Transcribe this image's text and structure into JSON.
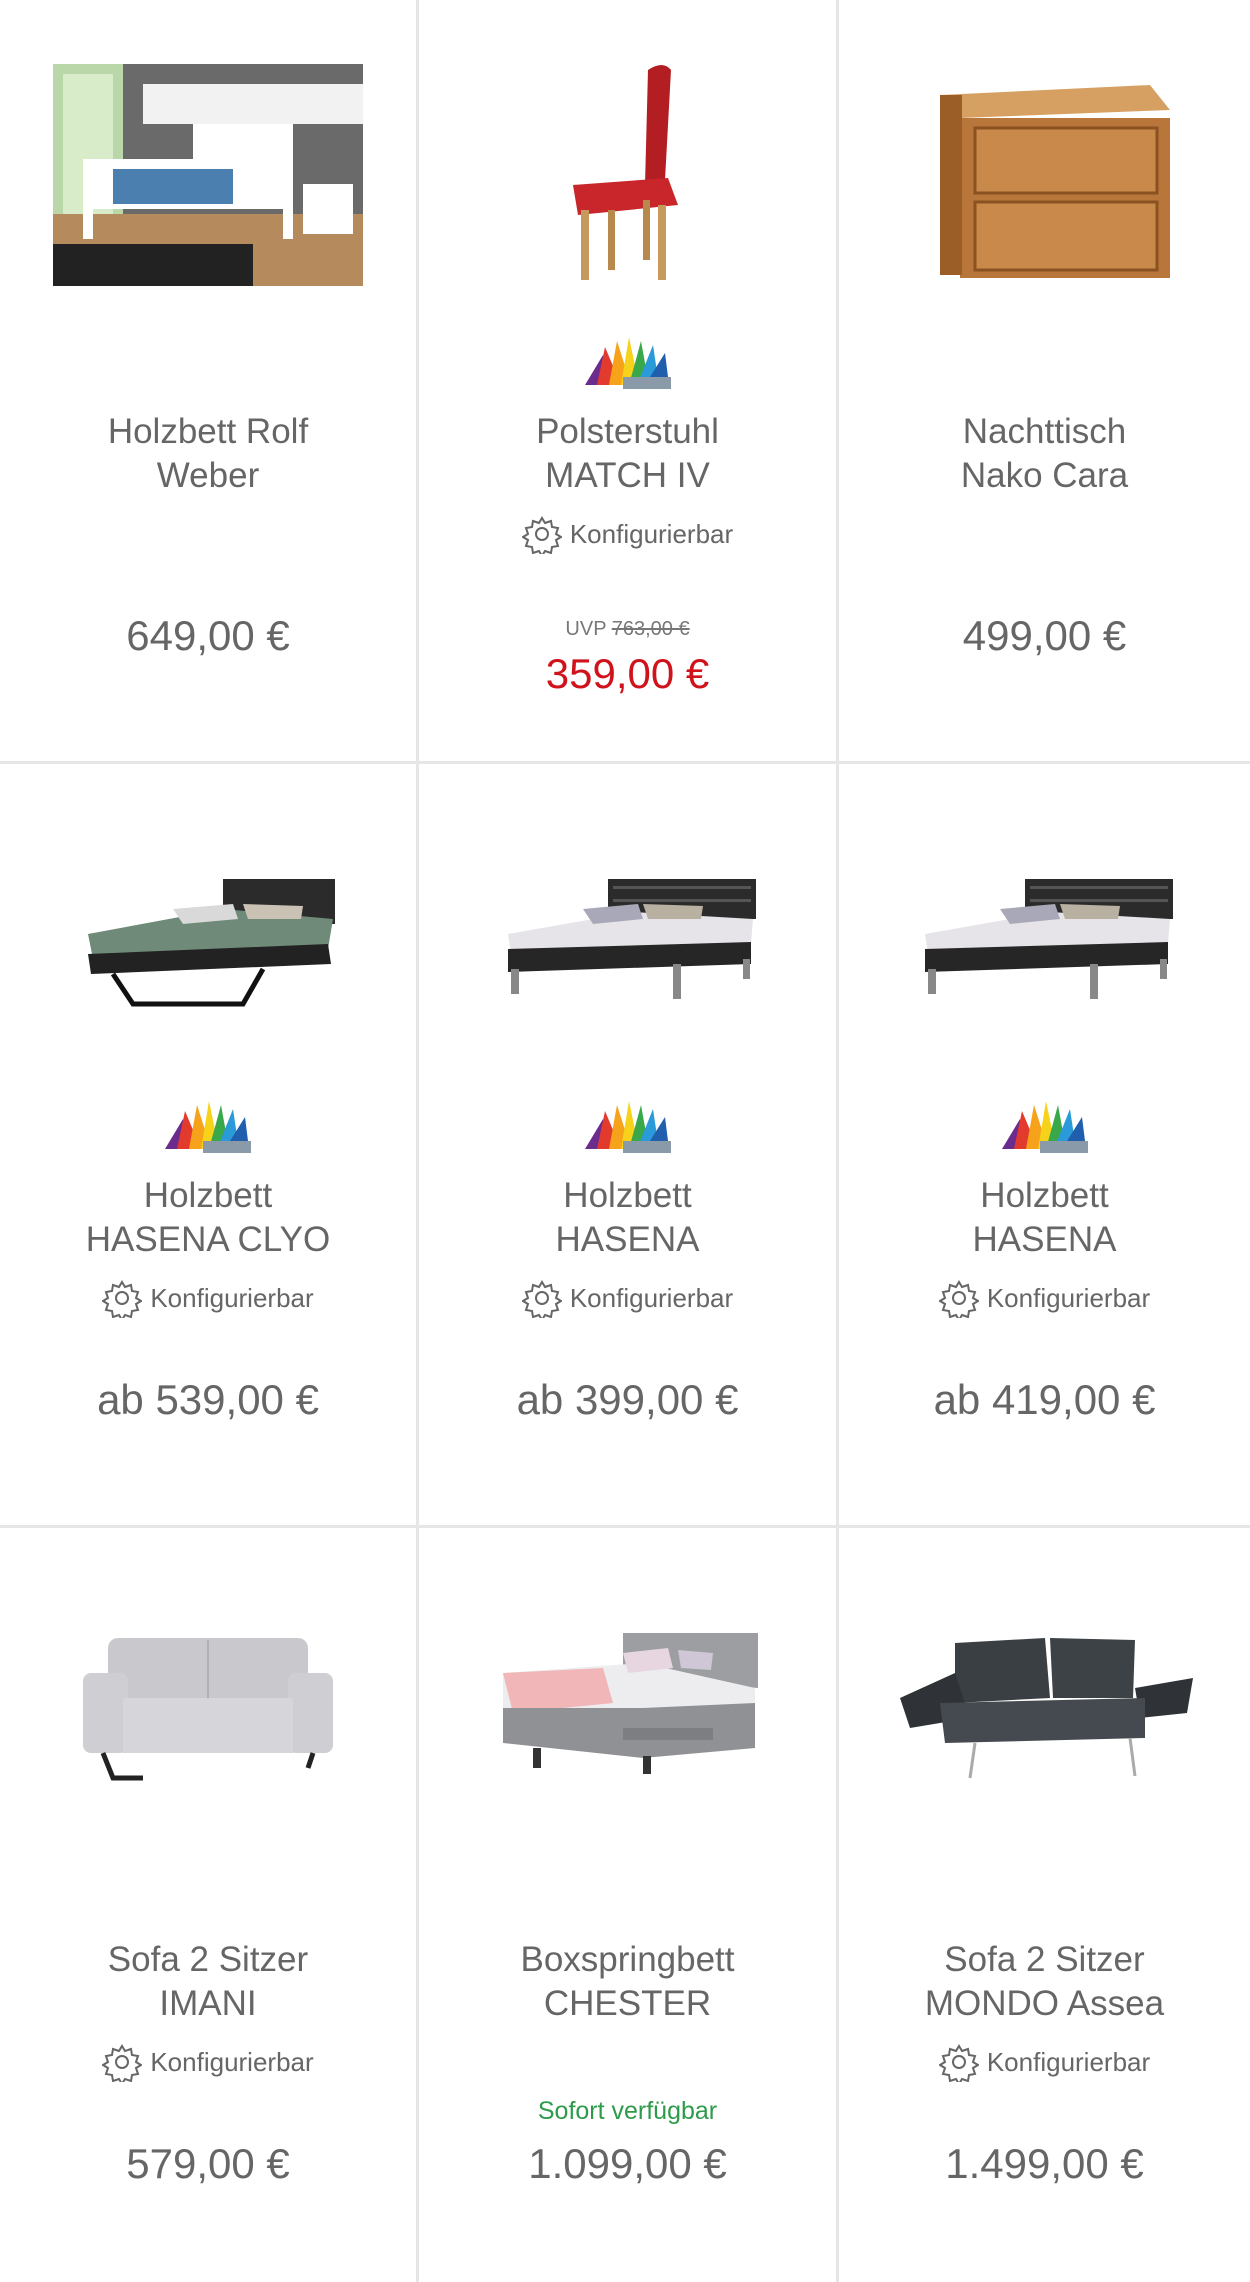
{
  "products": [
    {
      "name_line1": "Holzbett Rolf",
      "name_line2": "Weber",
      "price": "649,00 €",
      "image": "bed-photo",
      "color_swatch": false,
      "configurable": false
    },
    {
      "name_line1": "Polsterstuhl",
      "name_line2": "MATCH IV",
      "uvp_label": "UVP",
      "uvp_price": "763,00 €",
      "price": "359,00 €",
      "price_color": "#d0121b",
      "image": "red-chair-photo",
      "color_swatch": true,
      "configurable": true,
      "configurable_label": "Konfigurierbar"
    },
    {
      "name_line1": "Nachttisch",
      "name_line2": "Nako Cara",
      "price": "499,00 €",
      "image": "nightstand-photo",
      "color_swatch": false,
      "configurable": false
    },
    {
      "name_line1": "Holzbett",
      "name_line2": "HASENA CLYO",
      "price": "ab 539,00 €",
      "image": "black-bed-photo",
      "color_swatch": true,
      "configurable": true,
      "configurable_label": "Konfigurierbar"
    },
    {
      "name_line1": "Holzbett",
      "name_line2": "HASENA",
      "price": "ab 399,00 €",
      "image": "black-bed-photo",
      "color_swatch": true,
      "configurable": true,
      "configurable_label": "Konfigurierbar"
    },
    {
      "name_line1": "Holzbett",
      "name_line2": "HASENA",
      "price": "ab 419,00 €",
      "image": "black-bed-photo",
      "color_swatch": true,
      "configurable": true,
      "configurable_label": "Konfigurierbar"
    },
    {
      "name_line1": "Sofa 2 Sitzer",
      "name_line2": "IMANI",
      "price": "579,00 €",
      "image": "grey-sofa-photo",
      "color_swatch": false,
      "configurable": true,
      "configurable_label": "Konfigurierbar"
    },
    {
      "name_line1": "Boxspringbett",
      "name_line2": "CHESTER",
      "availability": "Sofort verfügbar",
      "availability_color": "#2e9b4b",
      "price": "1.099,00 €",
      "image": "boxspring-bed-photo",
      "color_swatch": false,
      "configurable": false
    },
    {
      "name_line1": "Sofa 2 Sitzer",
      "name_line2": "MONDO Assea",
      "price": "1.499,00 €",
      "image": "dark-sofa-photo",
      "color_swatch": false,
      "configurable": true,
      "configurable_label": "Konfigurierbar"
    }
  ],
  "colors": {
    "sale": "#d0121b",
    "available": "#2e9b4b",
    "text": "#666666",
    "divider": "#e6e6e6"
  }
}
